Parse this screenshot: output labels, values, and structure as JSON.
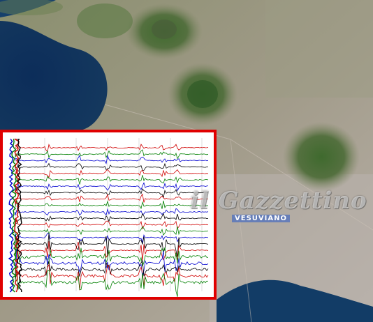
{
  "brand": {
    "name": "il Gazzettino",
    "tagline": "VESUVIANO"
  },
  "seismogram": {
    "series_colors": [
      "#d00000",
      "#008000",
      "#0000d0",
      "#000000"
    ],
    "border_color": "#e00000"
  }
}
